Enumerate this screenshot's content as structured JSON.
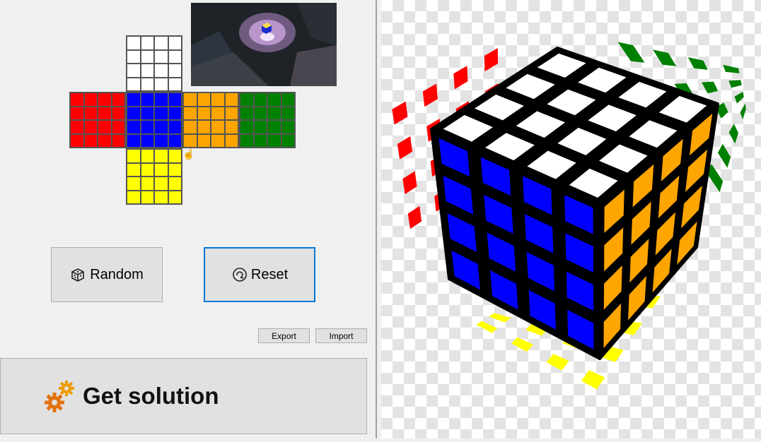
{
  "left_panel": {
    "net_colors": {
      "up": "#ffffff",
      "left": "#ff0000",
      "front": "#0000ff",
      "right": "#ffa500",
      "back": "#008000",
      "down": "#ffff00"
    },
    "buttons": {
      "random_label": "Random",
      "reset_label": "Reset",
      "export_label": "Export",
      "import_label": "Import",
      "solution_label": "Get solution"
    }
  },
  "cube_view": {
    "size": "4x4",
    "colors": {
      "top": "#ffffff",
      "front": "#0000ff",
      "right": "#ffa500",
      "left_shadow": "#ff0000",
      "back_shadow": "#008000",
      "bottom_shadow": "#ffff00"
    }
  }
}
